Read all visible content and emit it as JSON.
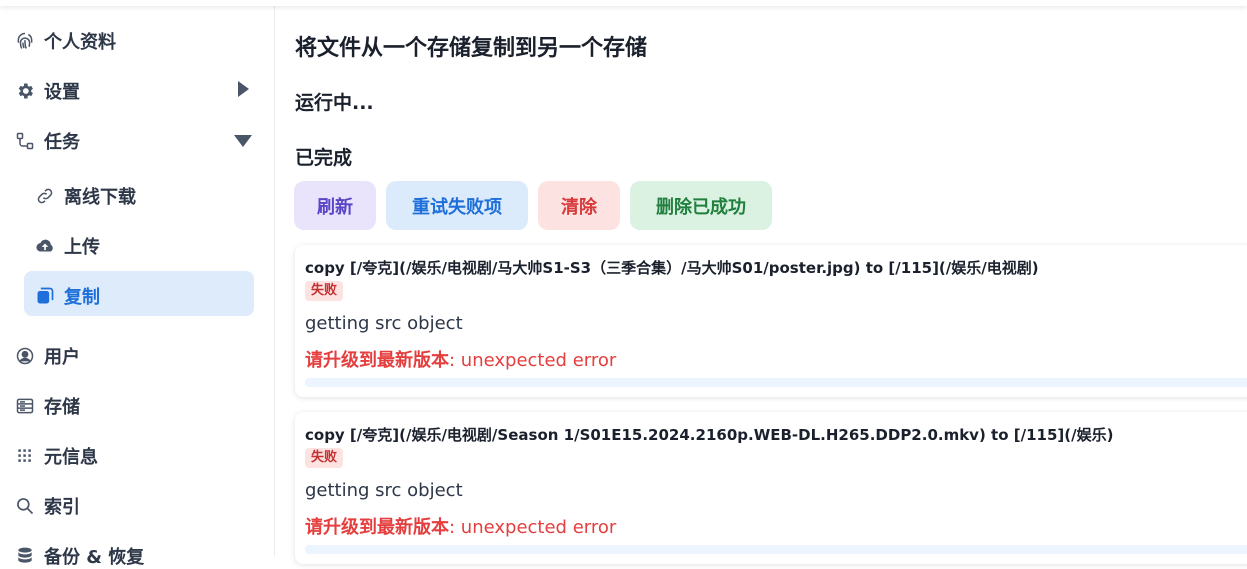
{
  "sidebar": {
    "items": [
      {
        "label": "个人资料",
        "icon": "fingerprint-icon"
      },
      {
        "label": "设置",
        "icon": "gear-icon"
      },
      {
        "label": "任务",
        "icon": "tasks-icon"
      },
      {
        "label": "离线下载",
        "icon": "link-icon"
      },
      {
        "label": "上传",
        "icon": "cloud-upload-icon"
      },
      {
        "label": "复制",
        "icon": "copy-icon"
      },
      {
        "label": "用户",
        "icon": "user-circle-icon"
      },
      {
        "label": "存储",
        "icon": "database-icon"
      },
      {
        "label": "元信息",
        "icon": "metadata-icon"
      },
      {
        "label": "索引",
        "icon": "search-icon"
      },
      {
        "label": "备份 & 恢复",
        "icon": "database-stack-icon"
      }
    ]
  },
  "main": {
    "title": "将文件从一个存储复制到另一个存储",
    "running_heading": "运行中...",
    "done_heading": "已完成",
    "buttons": {
      "refresh": "刷新",
      "retry_failed": "重试失败项",
      "clear": "清除",
      "delete_succeeded": "删除已成功"
    },
    "tasks": [
      {
        "name": "copy [/夸克](/娱乐/电视剧/马大帅S1-S3（三季合集）/马大帅S01/poster.jpg) to [/115](/娱乐/电视剧)",
        "state": "失败",
        "status": "getting src object",
        "error_prefix": "请升级到最新版本",
        "error_message": ": unexpected error",
        "progress": 0
      },
      {
        "name": "copy [/夸克](/娱乐/电视剧/Season 1/S01E15.2024.2160p.WEB-DL.H265.DDP2.0.mkv) to [/115](/娱乐)",
        "state": "失败",
        "status": "getting src object",
        "error_prefix": "请升级到最新版本",
        "error_message": ": unexpected error",
        "progress": 0
      }
    ]
  },
  "colors": {
    "accent": "#1e6fd9",
    "active_bg": "#deebfb",
    "error": "#e53e3e",
    "refresh_bg": "#e9e4fb",
    "retry_bg": "#dcebfb",
    "clear_bg": "#fde2e2",
    "delete_bg": "#dbf1e2"
  }
}
